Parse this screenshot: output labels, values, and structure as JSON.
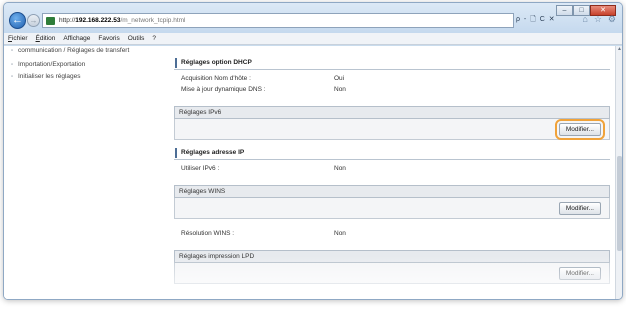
{
  "window": {
    "controls": [
      "–",
      "□",
      "✕"
    ]
  },
  "address": {
    "scheme": "http://",
    "host": "192.168.222.53",
    "path": "/m_network_tcpip.html",
    "tools": "ρ - 🗋 C ✕"
  },
  "menu": [
    {
      "label": "Fichier",
      "accel": "F",
      "rest": "ichier"
    },
    {
      "label": "Édition",
      "accel": "É",
      "rest": "dition"
    },
    {
      "label": "Affichage",
      "accel": "",
      "rest": "Affichage"
    },
    {
      "label": "Favoris",
      "accel": "",
      "rest": "Favoris"
    },
    {
      "label": "Outils",
      "accel": "",
      "rest": "Outils"
    },
    {
      "label": "?",
      "accel": "",
      "rest": "?"
    }
  ],
  "sidebar": {
    "items": [
      "communication / Réglages de transfert",
      "Importation/Exportation",
      "Initialiser les réglages"
    ]
  },
  "dhcp": {
    "title": "Réglages option DHCP",
    "rows": [
      {
        "label": "Acquisition Nom d'hôte :",
        "value": "Oui"
      },
      {
        "label": "Mise à jour dynamique DNS :",
        "value": "Non"
      }
    ]
  },
  "ipv6": {
    "title": "Réglages IPv6",
    "button": "Modifier..."
  },
  "ip_address": {
    "title": "Réglages adresse IP",
    "rows": [
      {
        "label": "Utiliser IPv6 :",
        "value": "Non"
      }
    ]
  },
  "wins": {
    "title": "Réglages WINS",
    "button": "Modifier...",
    "rows": [
      {
        "label": "Résolution WINS :",
        "value": "Non"
      }
    ]
  },
  "lpd": {
    "title": "Réglages impression LPD",
    "button": "Modifier..."
  },
  "colors": {
    "highlight": "#f0a239",
    "accent": "#4d6e96"
  }
}
